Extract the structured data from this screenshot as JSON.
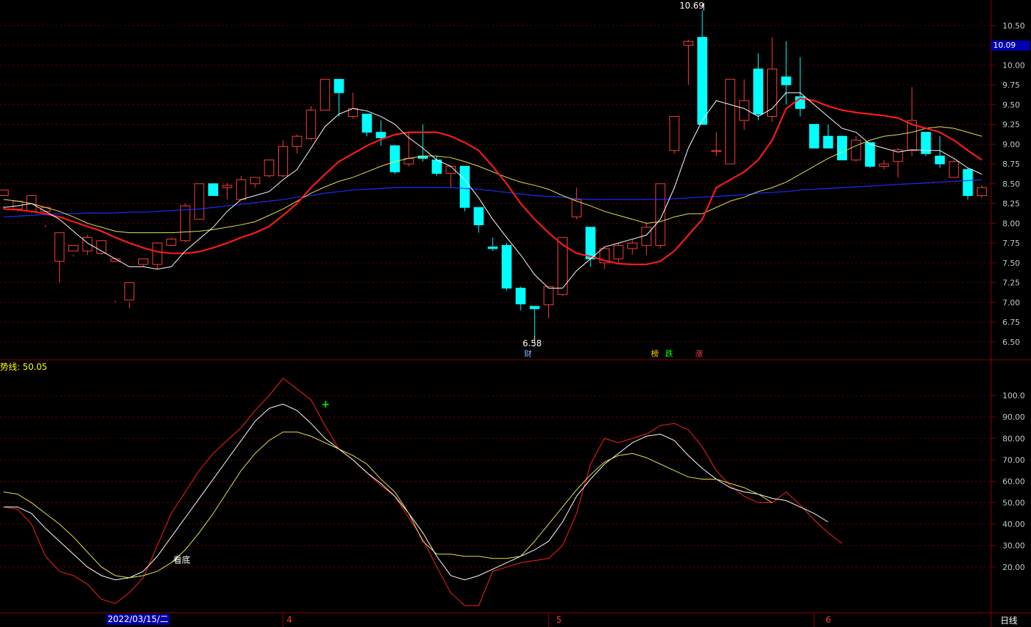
{
  "colors": {
    "background": "#000000",
    "up_candle": "#ff3b3b",
    "down_candle": "#00ffff",
    "ma5": "#ffffff",
    "ma10": "#ff1a1a",
    "ma20": "#e6e64a",
    "ma60": "#1f2bff",
    "grid": "#8b0000",
    "axis_text": "#c8c8c8"
  },
  "labels": {
    "indicator": "势线: 50.05",
    "current_price": "10.09",
    "date": "2022/03/15/二",
    "period": "日线",
    "high_mark": "10.69",
    "low_mark": "6.58",
    "bottom_signal": "看底"
  },
  "events": [
    {
      "label": "财",
      "color": "#7fb6ff"
    },
    {
      "label": "榜",
      "color": "#ffcc00"
    },
    {
      "label": "跌",
      "color": "#00ff00"
    },
    {
      "label": "涨",
      "color": "#ff4040"
    }
  ],
  "chart_data": [
    {
      "type": "candlestick",
      "ylim": [
        6.4,
        10.75
      ],
      "yticks": [
        "10.50",
        "10.25",
        "10.00",
        "9.75",
        "9.50",
        "9.25",
        "9.00",
        "8.75",
        "8.50",
        "8.25",
        "8.00",
        "7.75",
        "7.50",
        "7.25",
        "7.00",
        "6.75",
        "6.50"
      ],
      "month_ticks": [
        "4",
        "5",
        "6"
      ],
      "candles": [
        [
          8.35,
          8.42,
          8.22,
          8.18
        ],
        [
          8.18,
          8.28,
          8.15,
          8.22
        ],
        [
          8.15,
          8.35,
          8.13,
          8.25
        ],
        [
          8.15,
          8.2,
          7.98,
          7.95
        ],
        [
          7.52,
          7.88,
          7.25,
          7.88
        ],
        [
          7.65,
          7.72,
          7.6,
          7.58
        ],
        [
          7.65,
          7.82,
          7.6,
          7.85
        ],
        [
          7.62,
          7.78,
          7.6,
          7.78
        ],
        [
          7.52,
          7.55,
          7.02,
          7.0
        ],
        [
          7.03,
          7.25,
          7.0,
          6.93
        ],
        [
          7.48,
          7.55,
          7.45,
          7.5
        ],
        [
          7.48,
          7.75,
          7.42,
          7.76
        ],
        [
          7.72,
          7.8,
          7.71,
          7.82
        ],
        [
          7.78,
          8.22,
          7.76,
          8.25
        ],
        [
          8.05,
          8.5,
          8.05,
          8.5
        ],
        [
          8.5,
          8.35,
          8.38,
          8.48
        ],
        [
          8.45,
          8.48,
          8.3,
          8.51
        ],
        [
          8.3,
          8.55,
          8.3,
          8.6
        ],
        [
          8.5,
          8.58,
          8.45,
          8.58
        ],
        [
          8.6,
          8.8,
          8.58,
          8.8
        ],
        [
          8.6,
          8.97,
          8.58,
          9.05
        ],
        [
          8.97,
          9.1,
          8.88,
          9.12
        ],
        [
          9.07,
          9.43,
          9.05,
          9.48
        ],
        [
          9.43,
          9.82,
          9.5,
          9.82
        ],
        [
          9.82,
          9.65,
          9.35,
          9.82
        ],
        [
          9.35,
          9.45,
          9.32,
          9.65
        ],
        [
          9.38,
          9.15,
          9.1,
          9.38
        ],
        [
          9.15,
          9.08,
          8.98,
          9.3
        ],
        [
          8.98,
          8.65,
          8.62,
          8.99
        ],
        [
          8.75,
          8.82,
          8.72,
          9.15
        ],
        [
          8.85,
          8.82,
          8.78,
          9.25
        ],
        [
          8.8,
          8.63,
          8.6,
          8.85
        ],
        [
          8.63,
          8.72,
          8.45,
          8.72
        ],
        [
          8.72,
          8.2,
          8.15,
          8.72
        ],
        [
          8.2,
          7.98,
          7.88,
          8.2
        ],
        [
          7.7,
          7.68,
          7.65,
          7.82
        ],
        [
          7.72,
          7.18,
          7.15,
          7.75
        ],
        [
          7.18,
          6.98,
          6.9,
          7.2
        ],
        [
          6.95,
          6.92,
          6.58,
          6.95
        ],
        [
          6.97,
          7.2,
          6.8,
          7.2
        ],
        [
          7.1,
          7.82,
          7.08,
          7.82
        ],
        [
          8.08,
          8.3,
          8.05,
          8.45
        ],
        [
          7.95,
          7.55,
          7.45,
          7.95
        ],
        [
          7.5,
          7.68,
          7.42,
          7.7
        ],
        [
          7.55,
          7.72,
          7.5,
          7.75
        ],
        [
          7.68,
          7.75,
          7.6,
          7.8
        ],
        [
          7.72,
          7.95,
          7.6,
          8.0
        ],
        [
          7.72,
          8.5,
          7.68,
          8.5
        ],
        [
          8.92,
          9.35,
          8.88,
          9.35
        ],
        [
          10.25,
          10.3,
          9.75,
          10.32
        ],
        [
          10.35,
          9.25,
          9.25,
          10.69
        ],
        [
          8.92,
          8.92,
          8.85,
          9.15
        ],
        [
          8.75,
          9.82,
          8.75,
          9.82
        ],
        [
          9.3,
          9.55,
          9.18,
          9.82
        ],
        [
          9.95,
          9.38,
          9.3,
          10.15
        ],
        [
          9.35,
          9.95,
          9.28,
          10.35
        ],
        [
          9.85,
          9.75,
          9.5,
          10.3
        ],
        [
          9.6,
          9.45,
          9.35,
          10.1
        ],
        [
          9.25,
          8.95,
          8.95,
          9.25
        ],
        [
          9.1,
          8.95,
          8.98,
          9.25
        ],
        [
          9.1,
          8.8,
          8.8,
          9.1
        ],
        [
          8.8,
          9.05,
          8.78,
          9.1
        ],
        [
          9.02,
          8.72,
          8.7,
          9.02
        ],
        [
          8.72,
          8.75,
          8.68,
          8.8
        ],
        [
          8.78,
          8.93,
          8.58,
          8.95
        ],
        [
          8.92,
          9.3,
          8.85,
          9.72
        ],
        [
          9.15,
          8.88,
          8.85,
          9.15
        ],
        [
          8.85,
          8.75,
          8.7,
          9.1
        ],
        [
          8.58,
          8.78,
          8.6,
          8.8
        ],
        [
          8.68,
          8.35,
          8.3,
          8.7
        ],
        [
          8.35,
          8.45,
          8.32,
          8.48
        ]
      ],
      "ma5": [
        8.2,
        8.22,
        8.25,
        8.15,
        8.05,
        7.9,
        7.75,
        7.65,
        7.55,
        7.45,
        7.45,
        7.42,
        7.45,
        7.65,
        7.8,
        7.95,
        8.15,
        8.3,
        8.35,
        8.4,
        8.55,
        8.68,
        8.95,
        9.22,
        9.38,
        9.45,
        9.42,
        9.35,
        9.25,
        9.08,
        8.95,
        8.8,
        8.72,
        8.55,
        8.32,
        8.05,
        7.82,
        7.6,
        7.35,
        7.18,
        7.18,
        7.4,
        7.55,
        7.7,
        7.75,
        7.8,
        7.85,
        8.05,
        8.45,
        8.95,
        9.3,
        9.55,
        9.5,
        9.45,
        9.35,
        9.45,
        9.65,
        9.65,
        9.5,
        9.35,
        9.2,
        9.15,
        9.0,
        8.95,
        8.9,
        8.93,
        8.92,
        8.92,
        8.82,
        8.7,
        8.62
      ],
      "ma10": [
        8.18,
        8.17,
        8.15,
        8.12,
        8.08,
        8.02,
        7.96,
        7.9,
        7.82,
        7.75,
        7.69,
        7.64,
        7.62,
        7.62,
        7.64,
        7.69,
        7.75,
        7.82,
        7.88,
        7.96,
        8.1,
        8.25,
        8.45,
        8.62,
        8.78,
        8.88,
        8.98,
        9.06,
        9.12,
        9.15,
        9.15,
        9.15,
        9.1,
        9.02,
        8.92,
        8.72,
        8.5,
        8.25,
        8.05,
        7.88,
        7.73,
        7.62,
        7.58,
        7.53,
        7.49,
        7.48,
        7.48,
        7.52,
        7.65,
        7.85,
        8.05,
        8.45,
        8.55,
        8.65,
        8.8,
        9.05,
        9.45,
        9.58,
        9.55,
        9.48,
        9.43,
        9.4,
        9.38,
        9.36,
        9.33,
        9.25,
        9.2,
        9.15,
        9.05,
        8.92,
        8.8
      ],
      "ma20": [
        8.3,
        8.28,
        8.25,
        8.2,
        8.15,
        8.08,
        8.0,
        7.95,
        7.9,
        7.88,
        7.88,
        7.88,
        7.88,
        7.89,
        7.9,
        7.92,
        7.95,
        7.98,
        8.02,
        8.1,
        8.18,
        8.28,
        8.38,
        8.46,
        8.53,
        8.58,
        8.65,
        8.72,
        8.78,
        8.82,
        8.85,
        8.85,
        8.83,
        8.78,
        8.72,
        8.65,
        8.58,
        8.52,
        8.48,
        8.43,
        8.35,
        8.28,
        8.22,
        8.15,
        8.1,
        8.05,
        8.0,
        8.02,
        8.08,
        8.12,
        8.12,
        8.2,
        8.28,
        8.33,
        8.4,
        8.45,
        8.52,
        8.62,
        8.72,
        8.82,
        8.9,
        8.98,
        9.05,
        9.1,
        9.12,
        9.15,
        9.2,
        9.22,
        9.2,
        9.15,
        9.1
      ],
      "ma60": [
        8.08,
        8.09,
        8.1,
        8.11,
        8.12,
        8.12,
        8.13,
        8.13,
        8.13,
        8.14,
        8.14,
        8.15,
        8.16,
        8.17,
        8.18,
        8.2,
        8.22,
        8.24,
        8.26,
        8.28,
        8.3,
        8.33,
        8.35,
        8.38,
        8.4,
        8.42,
        8.43,
        8.44,
        8.45,
        8.45,
        8.45,
        8.45,
        8.45,
        8.44,
        8.43,
        8.41,
        8.39,
        8.37,
        8.35,
        8.34,
        8.33,
        8.31,
        8.3,
        8.3,
        8.3,
        8.3,
        8.3,
        8.3,
        8.31,
        8.32,
        8.33,
        8.34,
        8.35,
        8.36,
        8.38,
        8.39,
        8.4,
        8.42,
        8.43,
        8.44,
        8.45,
        8.46,
        8.47,
        8.48,
        8.49,
        8.5,
        8.51,
        8.52,
        8.53,
        8.54,
        8.55
      ]
    },
    {
      "type": "line",
      "ylim": [
        0,
        110
      ],
      "yticks": [
        "100.0",
        "90.00",
        "80.00",
        "70.00",
        "60.00",
        "50.00",
        "40.00",
        "30.00",
        "20.00"
      ],
      "series": [
        {
          "color": "#ff2020",
          "values": [
            48,
            47,
            40,
            25,
            18,
            16,
            12,
            5,
            3,
            8,
            15,
            30,
            45,
            55,
            65,
            73,
            79,
            85,
            93,
            100,
            108,
            103,
            98,
            86,
            75,
            70,
            64,
            58,
            53,
            43,
            33,
            20,
            8,
            2,
            2,
            18,
            20,
            22,
            23,
            24,
            30,
            45,
            68,
            80,
            78,
            80,
            82,
            86,
            87,
            84,
            76,
            65,
            58,
            53,
            50,
            50,
            55,
            49,
            42,
            36,
            31
          ]
        },
        {
          "color": "#ffffff",
          "values": [
            48,
            48,
            45,
            38,
            32,
            26,
            20,
            16,
            14,
            15,
            18,
            25,
            34,
            43,
            52,
            61,
            70,
            79,
            88,
            94,
            96,
            93,
            87,
            80,
            75,
            70,
            64,
            59,
            53,
            45,
            36,
            25,
            16,
            14,
            16,
            19,
            22,
            25,
            28,
            32,
            41,
            53,
            61,
            68,
            73,
            78,
            81,
            82,
            79,
            72,
            66,
            61,
            57,
            55,
            54,
            52,
            51,
            48,
            45,
            41
          ]
        },
        {
          "color": "#e6e64a",
          "values": [
            55,
            54,
            50,
            45,
            40,
            34,
            27,
            20,
            16,
            15,
            16,
            18,
            22,
            28,
            36,
            45,
            55,
            65,
            73,
            79,
            83,
            83,
            81,
            78,
            75,
            72,
            68,
            61,
            55,
            45,
            32,
            26,
            26,
            25,
            25,
            24,
            24,
            25,
            32,
            40,
            48,
            56,
            63,
            69,
            72,
            73,
            71,
            68,
            65,
            62,
            61,
            61,
            59,
            57,
            54,
            50
          ]
        }
      ]
    }
  ]
}
